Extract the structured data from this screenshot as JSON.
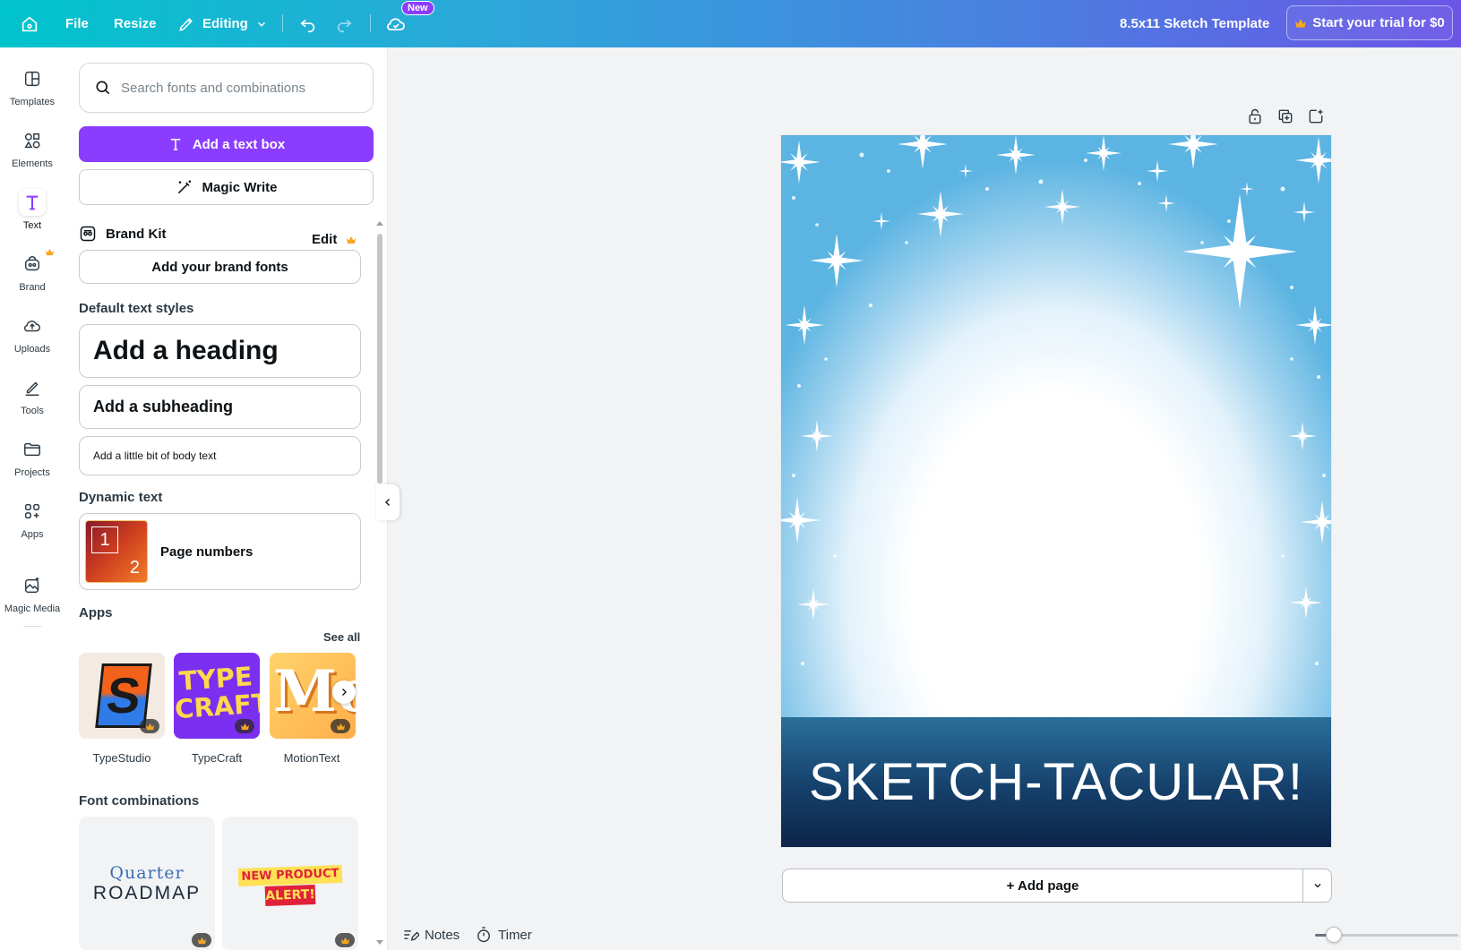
{
  "topbar": {
    "file": "File",
    "resize": "Resize",
    "editing": "Editing",
    "new_badge": "New",
    "doc_title": "8.5x11 Sketch Template",
    "trial": "Start your trial for $0"
  },
  "rail": {
    "items": [
      {
        "label": "Templates",
        "icon": "templates-icon"
      },
      {
        "label": "Elements",
        "icon": "elements-icon"
      },
      {
        "label": "Text",
        "icon": "text-icon"
      },
      {
        "label": "Brand",
        "icon": "brand-icon"
      },
      {
        "label": "Uploads",
        "icon": "uploads-icon"
      },
      {
        "label": "Tools",
        "icon": "tools-icon"
      },
      {
        "label": "Projects",
        "icon": "projects-icon"
      },
      {
        "label": "Apps",
        "icon": "apps-icon"
      },
      {
        "label": "Magic Media",
        "icon": "magic-media-icon"
      }
    ],
    "active": "Text"
  },
  "panel": {
    "search_placeholder": "Search fonts and combinations",
    "add_text_box": "Add a text box",
    "magic_write": "Magic Write",
    "brand_kit": "Brand Kit",
    "brand_edit": "Edit",
    "add_brand_fonts": "Add your brand fonts",
    "default_styles": "Default text styles",
    "heading": "Add a heading",
    "subheading": "Add a subheading",
    "body": "Add a little bit of body text",
    "dynamic_text": "Dynamic text",
    "page_numbers": "Page numbers",
    "page_num_1": "1",
    "page_num_2": "2",
    "apps_title": "Apps",
    "see_all": "See all",
    "apps": [
      {
        "name": "TypeStudio",
        "tile_text": "S"
      },
      {
        "name": "TypeCraft",
        "tile_text_1": "TYPE",
        "tile_text_2": "CRAFT"
      },
      {
        "name": "MotionText",
        "tile_text": "Mo"
      }
    ],
    "font_combinations": "Font combinations",
    "combos": [
      {
        "line1": "Quarter",
        "line2": "ROADMAP"
      },
      {
        "line1": "NEW PRODUCT",
        "line2": "ALERT!"
      }
    ]
  },
  "canvas": {
    "banner_text": "SKETCH-TACULAR!",
    "add_page": "+ Add page"
  },
  "bottombar": {
    "notes": "Notes",
    "timer": "Timer",
    "zoom_fraction": 0.13
  },
  "colors": {
    "accent": "#8b3dff",
    "crown": "#f5a623"
  }
}
